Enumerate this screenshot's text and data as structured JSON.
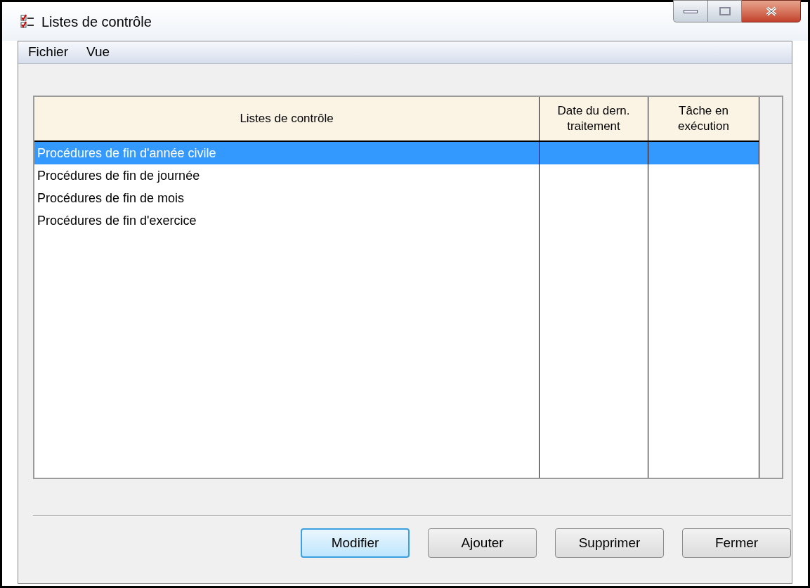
{
  "window": {
    "title": "Listes de contrôle"
  },
  "menu": [
    "Fichier",
    "Vue"
  ],
  "table": {
    "columns": [
      {
        "label": "Listes de contrôle"
      },
      {
        "label": "Date du dern. traitement"
      },
      {
        "label": "Tâche en exécution"
      }
    ],
    "rows": [
      {
        "name": "Procédures de fin d'année civile",
        "selected": true
      },
      {
        "name": "Procédures de fin de journée",
        "selected": false
      },
      {
        "name": "Procédures de fin de mois",
        "selected": false
      },
      {
        "name": "Procédures de fin d'exercice",
        "selected": false
      }
    ]
  },
  "buttons": [
    {
      "label": "Modifier",
      "default": true
    },
    {
      "label": "Ajouter",
      "default": false
    },
    {
      "label": "Supprimer",
      "default": false
    },
    {
      "label": "Fermer",
      "default": false
    }
  ]
}
